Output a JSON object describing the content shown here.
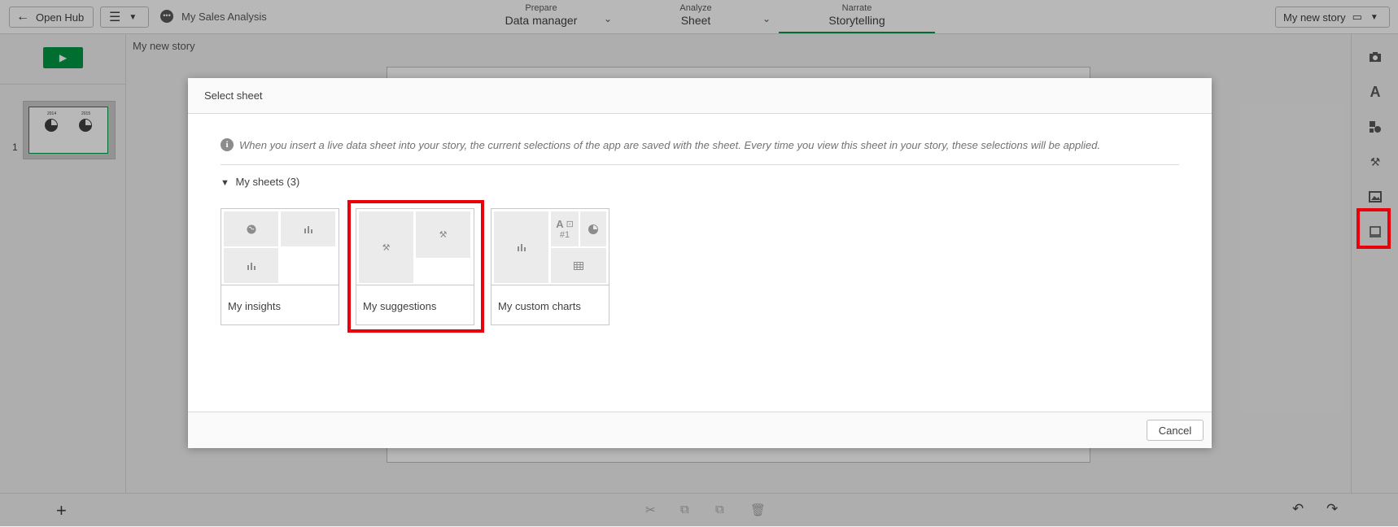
{
  "topbar": {
    "open_hub": "Open Hub",
    "app_name": "My Sales Analysis",
    "tabs": [
      {
        "small": "Prepare",
        "large": "Data manager"
      },
      {
        "small": "Analyze",
        "large": "Sheet"
      },
      {
        "small": "Narrate",
        "large": "Storytelling"
      }
    ],
    "story_select": "My new story"
  },
  "story": {
    "title": "My new story",
    "slide_number": "1",
    "thumb_labels": [
      "2014",
      "2015"
    ]
  },
  "dialog": {
    "title": "Select sheet",
    "info_text": "When you insert a live data sheet into your story, the current selections of the app are saved with the sheet. Every time you view this sheet in your story, these selections will be applied.",
    "section_title": "My sheets (3)",
    "sheets": [
      {
        "label": "My insights"
      },
      {
        "label": "My suggestions"
      },
      {
        "label": "My custom charts",
        "kpi_text": "#1"
      }
    ],
    "cancel": "Cancel"
  },
  "colors": {
    "accent_green": "#009845",
    "highlight_red": "#e8000a"
  }
}
